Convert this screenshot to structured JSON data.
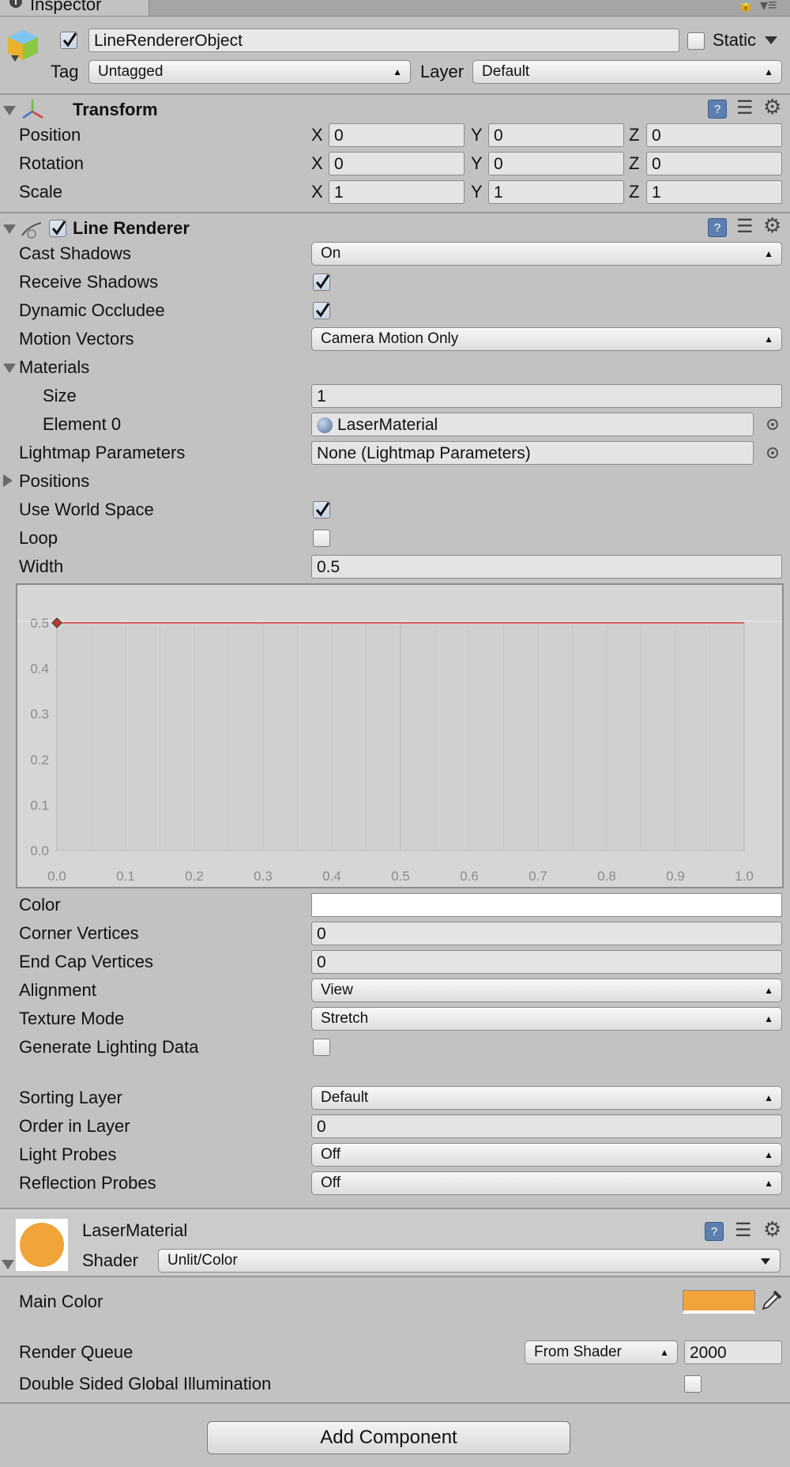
{
  "tab": {
    "icon_text": "i",
    "title": "Inspector"
  },
  "object": {
    "enabled": true,
    "name": "LineRendererObject",
    "static_label": "Static",
    "static_checked": false,
    "tag_label": "Tag",
    "tag_value": "Untagged",
    "layer_label": "Layer",
    "layer_value": "Default"
  },
  "transform": {
    "title": "Transform",
    "rows": [
      {
        "label": "Position",
        "x": "0",
        "y": "0",
        "z": "0"
      },
      {
        "label": "Rotation",
        "x": "0",
        "y": "0",
        "z": "0"
      },
      {
        "label": "Scale",
        "x": "1",
        "y": "1",
        "z": "1"
      }
    ],
    "axis_x": "X",
    "axis_y": "Y",
    "axis_z": "Z"
  },
  "line_renderer": {
    "title": "Line Renderer",
    "enabled": true,
    "cast_shadows_label": "Cast Shadows",
    "cast_shadows_value": "On",
    "receive_shadows_label": "Receive Shadows",
    "receive_shadows": true,
    "dynamic_occludee_label": "Dynamic Occludee",
    "dynamic_occludee": true,
    "motion_vectors_label": "Motion Vectors",
    "motion_vectors_value": "Camera Motion Only",
    "materials_label": "Materials",
    "size_label": "Size",
    "size_value": "1",
    "element0_label": "Element 0",
    "element0_value": "LaserMaterial",
    "lightmap_label": "Lightmap Parameters",
    "lightmap_value": "None (Lightmap Parameters)",
    "positions_label": "Positions",
    "world_space_label": "Use World Space",
    "world_space": true,
    "loop_label": "Loop",
    "loop": false,
    "width_label": "Width",
    "width_value": "0.5",
    "color_label": "Color",
    "color_value": "#ffffff",
    "corner_label": "Corner Vertices",
    "corner_value": "0",
    "endcap_label": "End Cap Vertices",
    "endcap_value": "0",
    "alignment_label": "Alignment",
    "alignment_value": "View",
    "texture_mode_label": "Texture Mode",
    "texture_mode_value": "Stretch",
    "gen_lighting_label": "Generate Lighting Data",
    "gen_lighting": false,
    "sorting_layer_label": "Sorting Layer",
    "sorting_layer_value": "Default",
    "order_label": "Order in Layer",
    "order_value": "0",
    "light_probes_label": "Light Probes",
    "light_probes_value": "Off",
    "reflection_probes_label": "Reflection Probes",
    "reflection_probes_value": "Off"
  },
  "chart_data": {
    "type": "line",
    "x_ticks": [
      "0.0",
      "0.1",
      "0.2",
      "0.3",
      "0.4",
      "0.5",
      "0.6",
      "0.7",
      "0.8",
      "0.9",
      "1.0"
    ],
    "y_ticks": [
      "0.0",
      "0.1",
      "0.2",
      "0.3",
      "0.4",
      "0.5"
    ],
    "xlim": [
      0,
      1
    ],
    "ylim": [
      0,
      0.5
    ],
    "series": [
      {
        "x": [
          0,
          1
        ],
        "y": [
          0.5,
          0.5
        ],
        "color": "#d23a3a"
      }
    ],
    "keys": [
      {
        "x": 0,
        "y": 0.5
      }
    ],
    "grid": true
  },
  "material": {
    "name": "LaserMaterial",
    "preview_color": "#f0a43a",
    "shader_label": "Shader",
    "shader_value": "Unlit/Color",
    "main_color_label": "Main Color",
    "main_color_value": "#f0a43a",
    "render_queue_label": "Render Queue",
    "render_queue_mode": "From Shader",
    "render_queue_value": "2000",
    "double_sided_label": "Double Sided Global Illumination",
    "double_sided": false
  },
  "add_component_label": "Add Component"
}
